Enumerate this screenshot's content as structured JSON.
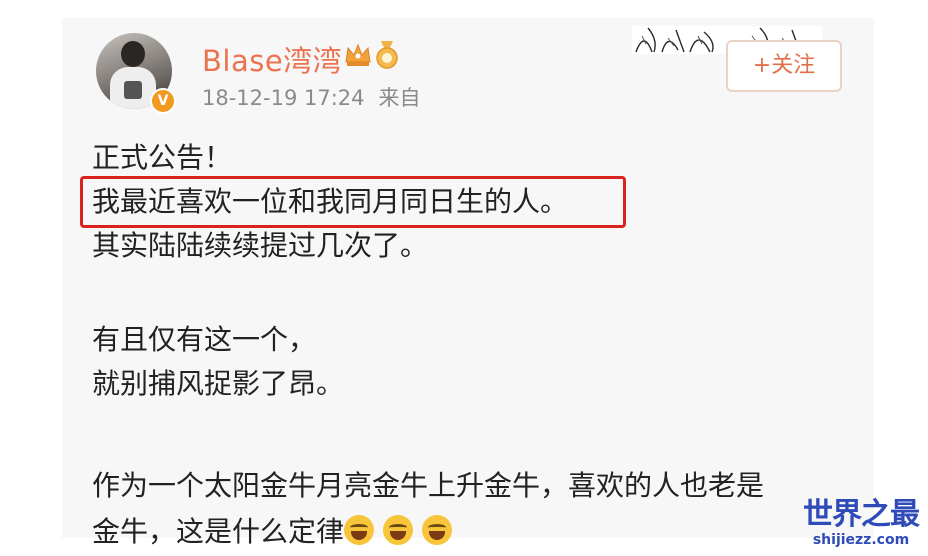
{
  "user": {
    "name": "Blase湾湾",
    "verified_badge": "V",
    "crown_icon": "crown-icon",
    "medal_icon": "medal-icon"
  },
  "meta": {
    "timestamp": "18-12-19 17:24",
    "source": "来自"
  },
  "follow_button": {
    "label": "+关注"
  },
  "post": {
    "lines": [
      "正式公告！",
      "我最近喜欢一位和我同月同日生的人。",
      "其实陆陆续续提过几次了。",
      "",
      "有且仅有这一个，",
      "就别捕风捉影了昂。",
      "",
      "作为一个太阳金牛月亮金牛上升金牛，喜欢的人也老是",
      "金牛，这是什么定律"
    ],
    "trailing_emojis": [
      "laugh-emoji",
      "laugh-emoji",
      "laugh-emoji"
    ],
    "highlight_color": "#d8241c"
  },
  "watermark": {
    "logo_text": "世界之最",
    "url": "shijiezz.com",
    "color": "#2f4bb8"
  },
  "colors": {
    "username": "#eb7350",
    "meta": "#8a8a8a",
    "body_text": "#222222",
    "follow": "#e0704a"
  }
}
